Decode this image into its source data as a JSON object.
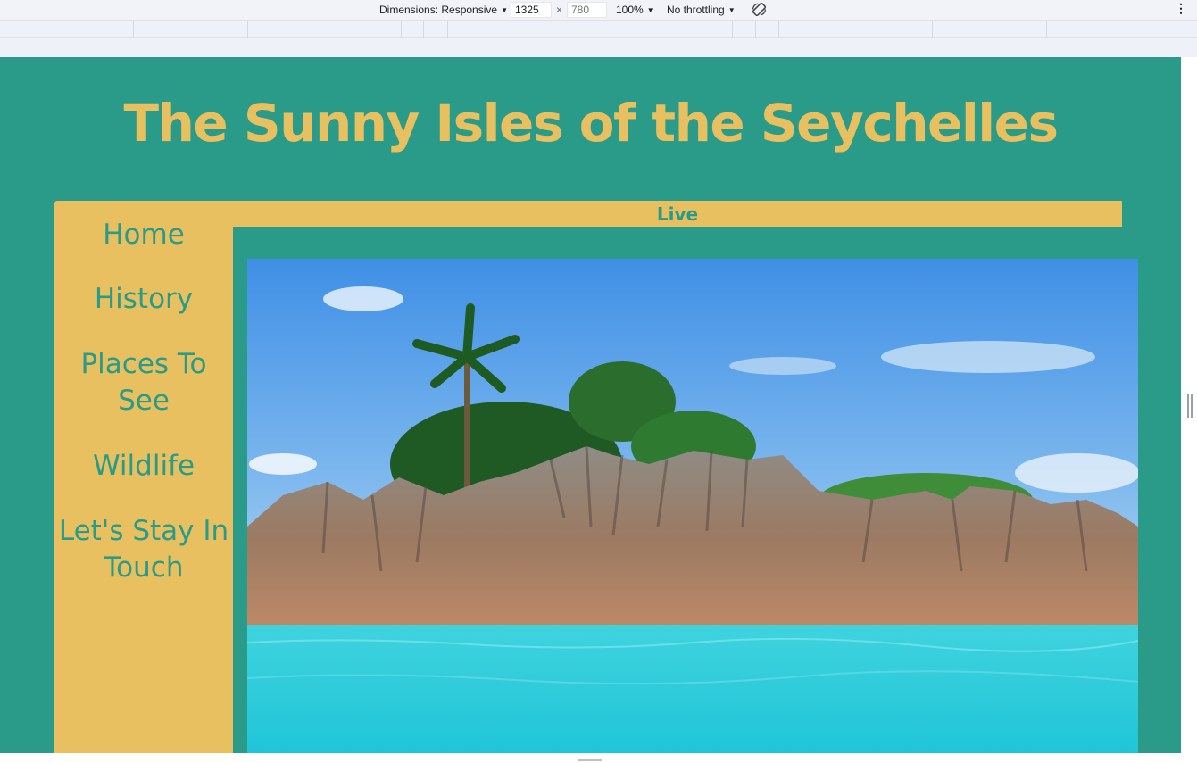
{
  "devtools": {
    "dimensions_label": "Dimensions: Responsive",
    "width_value": "1325",
    "height_placeholder": "780",
    "times": "×",
    "zoom": "100%",
    "throttling": "No throttling",
    "caret": "▼",
    "more": "⋮"
  },
  "page": {
    "title": "The Sunny Isles of the Seychelles",
    "banner": "Live",
    "nav": {
      "home": "Home",
      "history": "History",
      "places": "Places To See",
      "wildlife": "Wildlife",
      "touch": "Let's Stay In Touch"
    },
    "colors": {
      "background": "#2a9b89",
      "accent": "#e8c060"
    }
  }
}
